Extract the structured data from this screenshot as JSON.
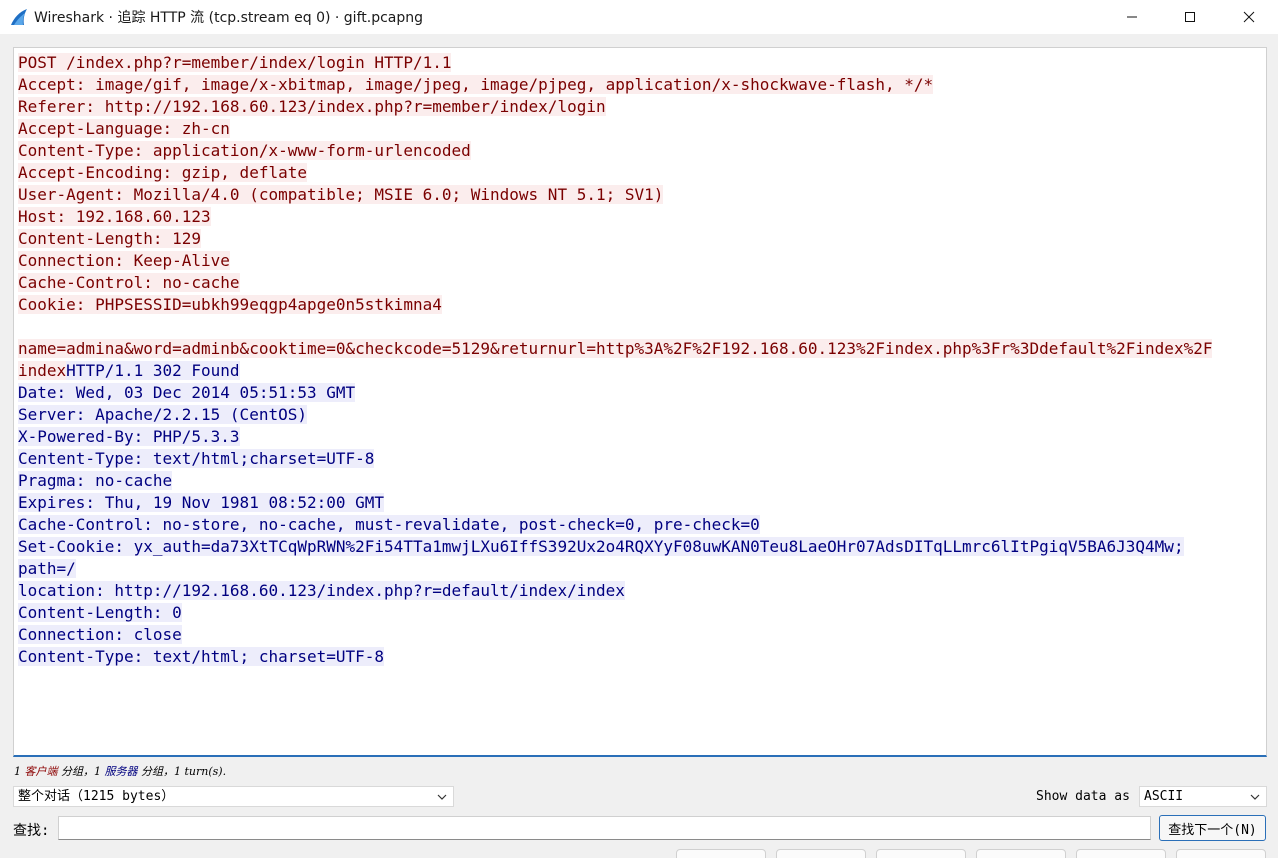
{
  "window": {
    "title": "Wireshark · 追踪 HTTP 流 (tcp.stream eq 0) · gift.pcapng"
  },
  "stream": {
    "client_lines": [
      "POST /index.php?r=member/index/login HTTP/1.1",
      "Accept: image/gif, image/x-xbitmap, image/jpeg, image/pjpeg, application/x-shockwave-flash, */*",
      "Referer: http://192.168.60.123/index.php?r=member/index/login",
      "Accept-Language: zh-cn",
      "Content-Type: application/x-www-form-urlencoded",
      "Accept-Encoding: gzip, deflate",
      "User-Agent: Mozilla/4.0 (compatible; MSIE 6.0; Windows NT 5.1; SV1)",
      "Host: 192.168.60.123",
      "Content-Length: 129",
      "Connection: Keep-Alive",
      "Cache-Control: no-cache",
      "Cookie: PHPSESSID=ubkh99eqgp4apge0n5stkimna4",
      "",
      "name=admina&word=adminb&cooktime=0&checkcode=5129&returnurl=http%3A%2F%2F192.168.60.123%2Findex.php%3Fr%3Ddefault%2Findex%2F",
      "index"
    ],
    "server_lines": [
      "HTTP/1.1 302 Found",
      "Date: Wed, 03 Dec 2014 05:51:53 GMT",
      "Server: Apache/2.2.15 (CentOS)",
      "X-Powered-By: PHP/5.3.3",
      "Centent-Type: text/html;charset=UTF-8",
      "Pragma: no-cache",
      "Expires: Thu, 19 Nov 1981 08:52:00 GMT",
      "Cache-Control: no-store, no-cache, must-revalidate, post-check=0, pre-check=0",
      "Set-Cookie: yx_auth=da73XtTCqWpRWN%2Fi54TTa1mwjLXu6IffS392Ux2o4RQXYyF08uwKAN0Teu8LaeOHr07AdsDITqLLmrc6lItPgiqV5BA6J3Q4Mw;",
      "path=/",
      "location: http://192.168.60.123/index.php?r=default/index/index",
      "Content-Length: 0",
      "Connection: close",
      "Content-Type: text/html; charset=UTF-8"
    ]
  },
  "status": {
    "prefix": "1 ",
    "client_word": "客户端",
    "middle": " 分组，1 ",
    "server_word": "服务器",
    "suffix": " 分组，1 turn(s)."
  },
  "controls": {
    "conversation_value": "整个对话（1215 bytes）",
    "show_data_label": "Show data as",
    "data_format_value": "ASCII",
    "find_label": "查找:",
    "find_value": "",
    "find_next_label": "查找下一个(N)"
  },
  "colors": {
    "client_bg": "#fbeded",
    "client_fg": "#7a0000",
    "server_bg": "#ededfb",
    "server_fg": "#000080",
    "focus_accent": "#2a6fb8"
  },
  "icons": {
    "app": "wireshark-fin-icon",
    "minimize": "minimize-icon",
    "maximize": "maximize-icon",
    "close": "close-icon",
    "dropdown": "chevron-down-icon"
  }
}
